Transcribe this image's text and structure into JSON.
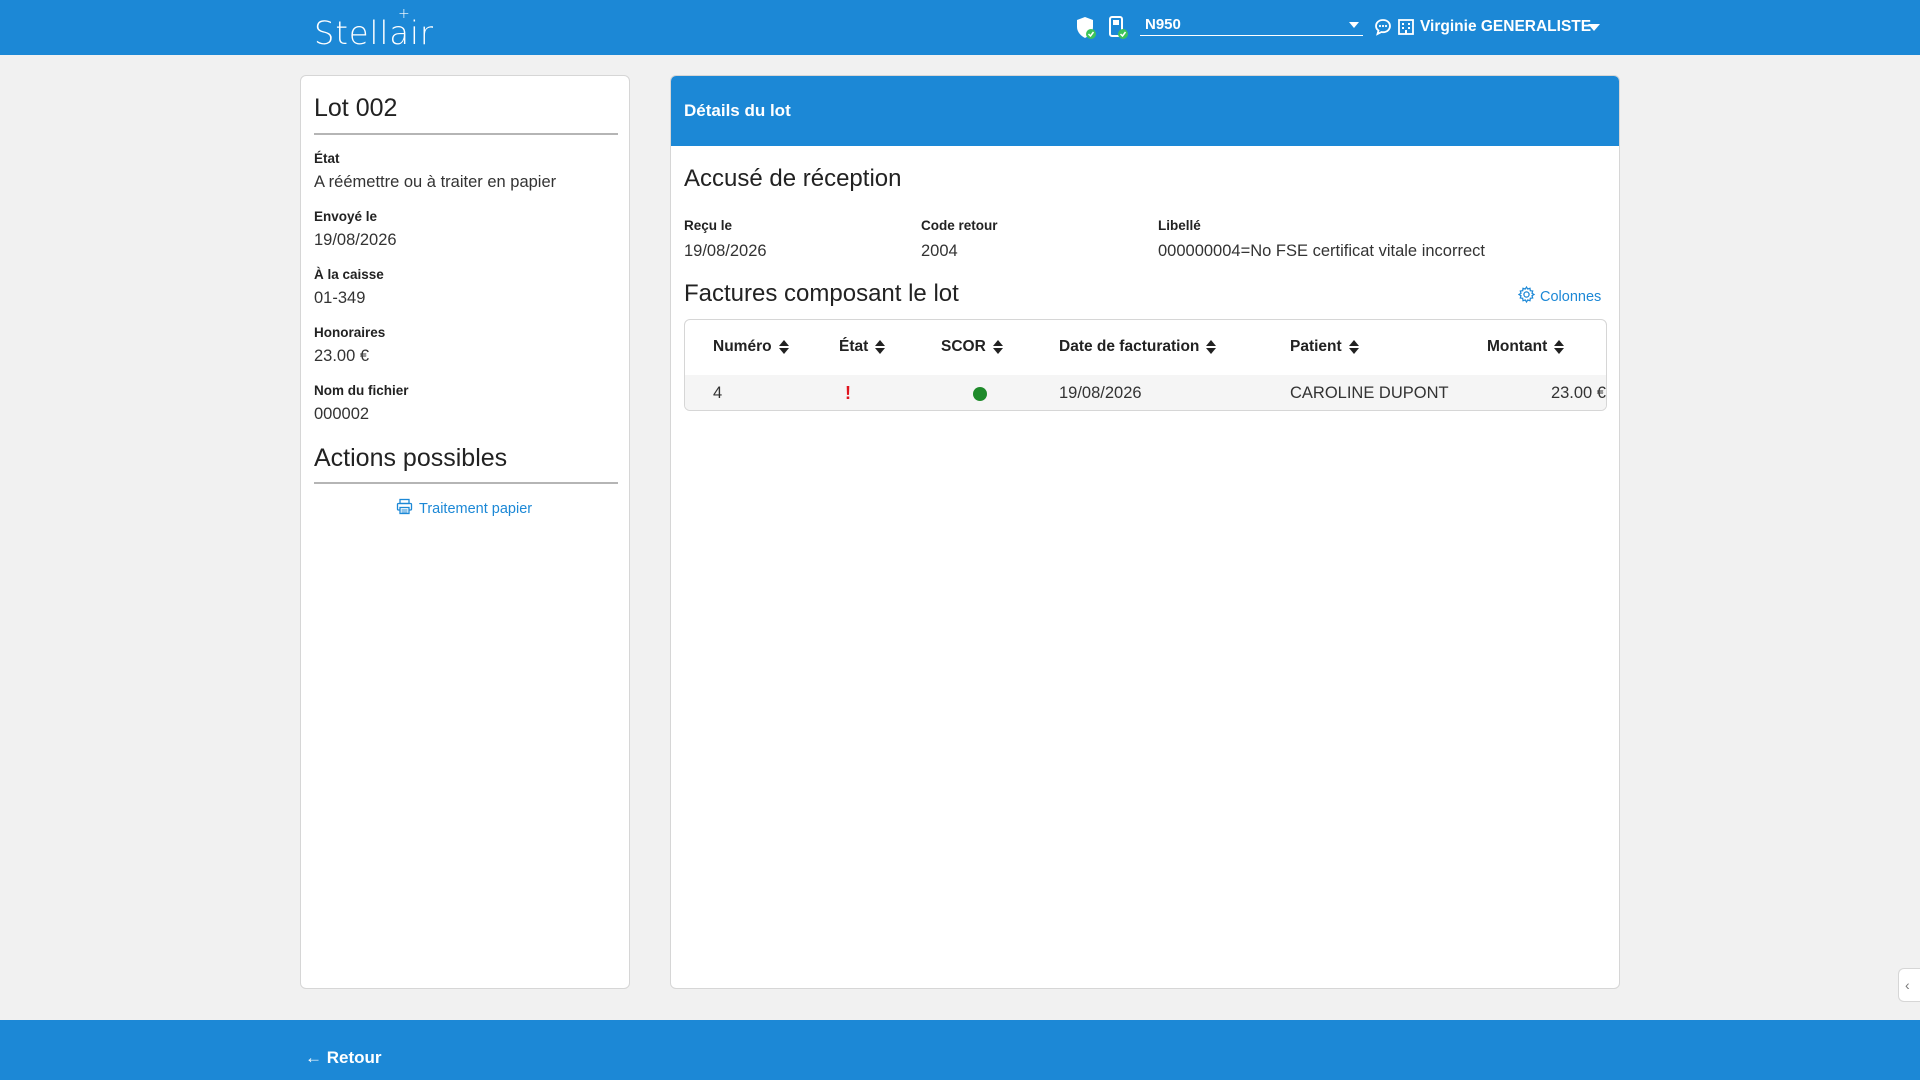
{
  "app": {
    "name": "Stellair"
  },
  "topbar": {
    "device_select_value": "N950",
    "user_name": "Virginie GENERALISTE"
  },
  "lot": {
    "title": "Lot 002",
    "fields": [
      {
        "label": "État",
        "value": "A réémettre ou à traiter en papier"
      },
      {
        "label": "Envoyé le",
        "value": "19/08/2026"
      },
      {
        "label": "À la caisse",
        "value": "01-349"
      },
      {
        "label": "Honoraires",
        "value": "23.00 €"
      },
      {
        "label": "Nom du fichier",
        "value": "000002"
      }
    ],
    "actions_title": "Actions possibles",
    "actions": [
      {
        "label": "Traitement papier",
        "icon": "printer-icon"
      }
    ]
  },
  "details": {
    "header": "Détails du lot",
    "ack_title": "Accusé de réception",
    "ack": {
      "received_label": "Reçu le",
      "received_value": "19/08/2026",
      "code_label": "Code retour",
      "code_value": "2004",
      "libelle_label": "Libellé",
      "libelle_value": "000000004=No FSE certificat vitale incorrect"
    },
    "invoices_title": "Factures composant le lot",
    "columns_label": "Colonnes",
    "table": {
      "headers": [
        "Numéro",
        "État",
        "SCOR",
        "Date de facturation",
        "Patient",
        "Montant"
      ],
      "rows": [
        {
          "numero": "4",
          "etat": "!",
          "scor": "green-dot",
          "date": "19/08/2026",
          "patient": "CAROLINE DUPONT",
          "montant": "23.00 €"
        }
      ]
    }
  },
  "footer": {
    "back_label": "← Retour"
  },
  "colors": {
    "primary": "#1c88d6",
    "error": "#e0141e",
    "success": "#1e8a2a",
    "background": "#f1f1f1"
  }
}
